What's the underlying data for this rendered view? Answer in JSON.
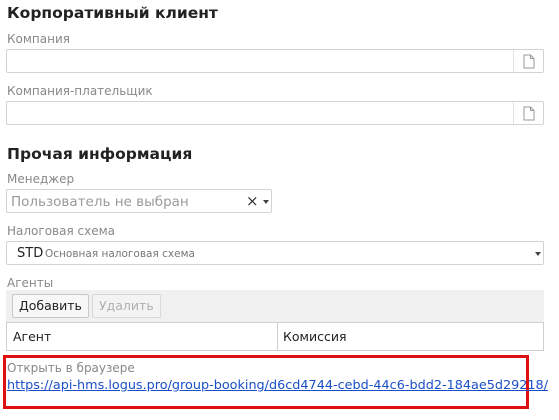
{
  "corporate": {
    "title": "Корпоративный клиент",
    "company_label": "Компания",
    "company_value": "",
    "payer_label": "Компания-плательщик",
    "payer_value": ""
  },
  "other": {
    "title": "Прочая информация",
    "manager_label": "Менеджер",
    "manager_placeholder": "Пользователь не выбран",
    "clear_symbol": "×",
    "tax_label": "Налоговая схема",
    "tax_code": "STD",
    "tax_desc": "Основная налоговая схема"
  },
  "agents": {
    "label": "Агенты",
    "add_label": "Добавить",
    "delete_label": "Удалить",
    "columns": [
      "Агент",
      "Комиссия"
    ]
  },
  "browser": {
    "label": "Открыть в браузере",
    "url": "https://api-hms.logus.pro/group-booking/d6cd4744-cebd-44c6-bdd2-184ae5d29218/"
  },
  "icons": {
    "document": "document-icon",
    "clear": "clear-icon",
    "dropdown": "chevron-down-icon"
  },
  "colors": {
    "highlight": "#e01010",
    "link": "#1a4fc9"
  }
}
